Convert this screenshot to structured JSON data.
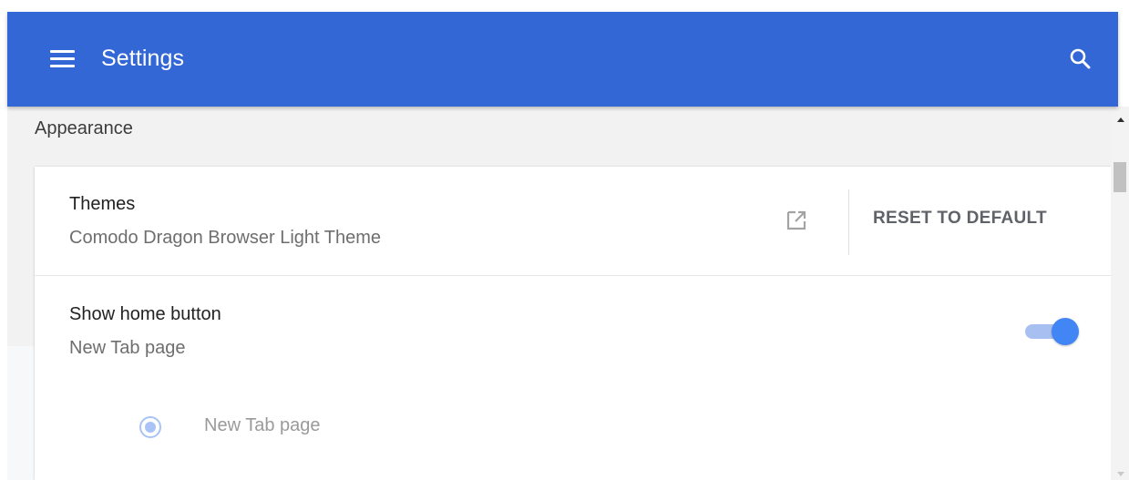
{
  "header": {
    "title": "Settings",
    "menu_icon": "hamburger-menu-icon",
    "search_icon": "search-icon",
    "background_color": "#3367d6"
  },
  "section": {
    "title": "Appearance"
  },
  "themes": {
    "label": "Themes",
    "value": "Comodo Dragon Browser Light Theme",
    "open_icon": "external-link-icon",
    "reset_label": "RESET TO DEFAULT"
  },
  "home_button": {
    "label": "Show home button",
    "subtitle": "New Tab page",
    "enabled": true,
    "accent_color": "#4285f4",
    "option": {
      "label": "New Tab page",
      "selected": true
    }
  }
}
